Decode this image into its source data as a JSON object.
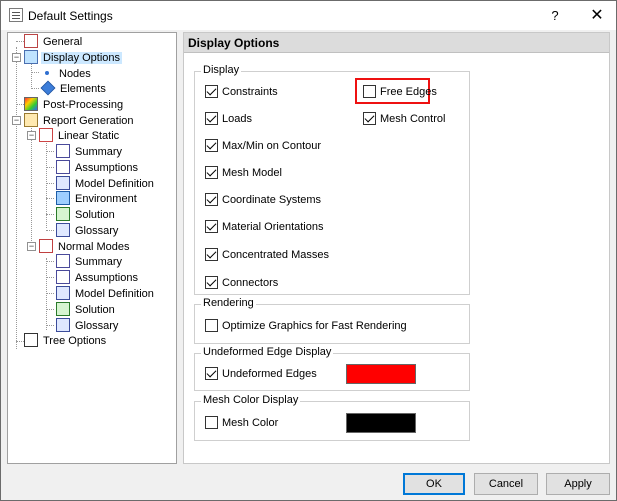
{
  "window": {
    "title": "Default Settings",
    "help_glyph": "?",
    "close_glyph": "✕"
  },
  "tree": {
    "items": [
      {
        "label": "General"
      },
      {
        "label": "Display Options"
      },
      {
        "label": "Nodes"
      },
      {
        "label": "Elements"
      },
      {
        "label": "Post-Processing"
      },
      {
        "label": "Report Generation"
      },
      {
        "label": "Linear Static"
      },
      {
        "label": "Summary"
      },
      {
        "label": "Assumptions"
      },
      {
        "label": "Model Definition"
      },
      {
        "label": "Environment"
      },
      {
        "label": "Solution"
      },
      {
        "label": "Glossary"
      },
      {
        "label": "Normal Modes"
      },
      {
        "label": "Summary"
      },
      {
        "label": "Assumptions"
      },
      {
        "label": "Model Definition"
      },
      {
        "label": "Solution"
      },
      {
        "label": "Glossary"
      },
      {
        "label": "Tree Options"
      }
    ],
    "collapse_glyph": "−"
  },
  "pane": {
    "title": "Display Options"
  },
  "display": {
    "label": "Display",
    "constraints": "Constraints",
    "loads": "Loads",
    "maxmin": "Max/Min on Contour",
    "mesh_model": "Mesh Model",
    "coord": "Coordinate Systems",
    "material": "Material Orientations",
    "masses": "Concentrated Masses",
    "connectors": "Connectors",
    "free_edges": "Free Edges",
    "mesh_control": "Mesh Control",
    "checked": {
      "constraints": true,
      "loads": true,
      "maxmin": true,
      "mesh_model": true,
      "coord": true,
      "material": true,
      "masses": true,
      "connectors": true,
      "free_edges": false,
      "mesh_control": true
    }
  },
  "rendering": {
    "label": "Rendering",
    "optimize": "Optimize Graphics for Fast Rendering",
    "optimize_checked": false
  },
  "undeformed": {
    "label": "Undeformed Edge Display",
    "edges": "Undeformed Edges",
    "edges_checked": true,
    "color": "#ff0000"
  },
  "mesh_color": {
    "label": "Mesh Color Display",
    "mesh_color": "Mesh Color",
    "mesh_color_checked": false,
    "color": "#000000"
  },
  "buttons": {
    "ok": "OK",
    "cancel": "Cancel",
    "apply": "Apply"
  },
  "colors": {
    "highlight": "#e11111",
    "selection": "#cce8ff",
    "default_button_border": "#0078d7"
  }
}
